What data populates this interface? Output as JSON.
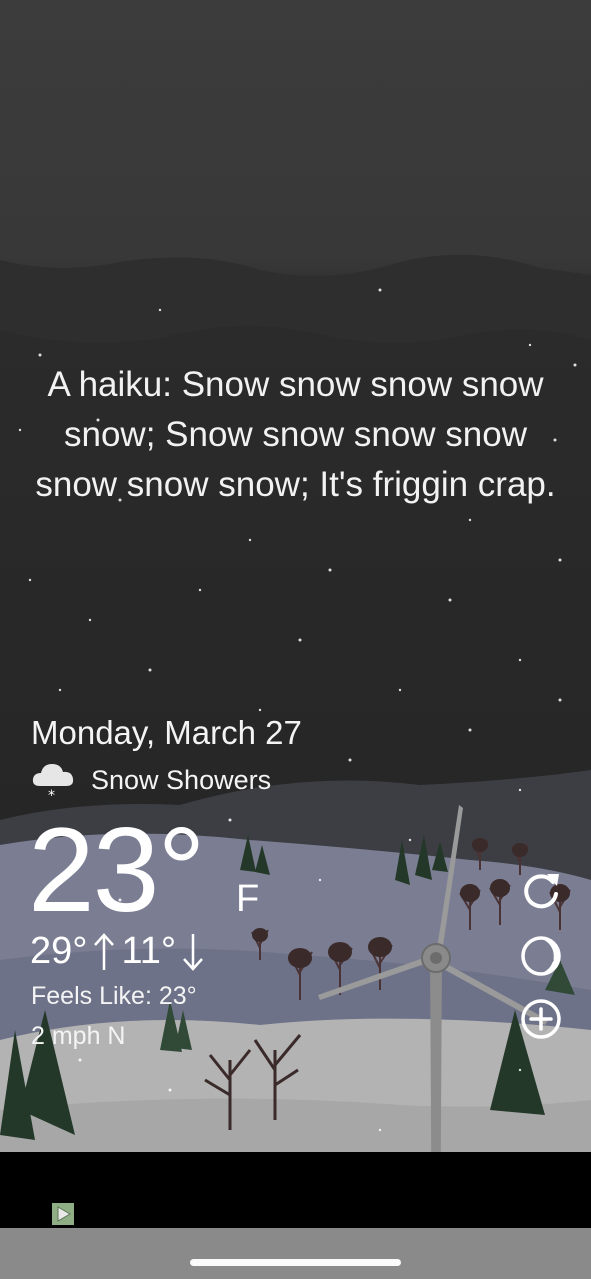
{
  "haiku": "A haiku: Snow snow snow snow snow; Snow snow snow snow snow snow snow; It's friggin crap.",
  "weather": {
    "date": "Monday, March 27",
    "condition": "Snow Showers",
    "condition_icon": "snow-cloud-icon",
    "temperature": "23°",
    "unit": "F",
    "high": "29°",
    "low": "11°",
    "feels_like": "Feels Like: 23°",
    "wind": "2 mph N"
  },
  "controls": {
    "refresh_icon": "refresh-icon",
    "theme_icon": "moon-theme-icon",
    "add_icon": "add-location-icon"
  },
  "ad": {
    "icon": "ad-play-icon"
  },
  "colors": {
    "sky_top": "#3a3a3a",
    "sky_bottom": "#222222",
    "far_hills": "#3d3d42",
    "mid_hills": "#7c7f92",
    "snow": "#b5b5b5",
    "tree": "#243a2a",
    "ad_bar": "#000000",
    "bottom_bar": "#8a8a8a"
  }
}
